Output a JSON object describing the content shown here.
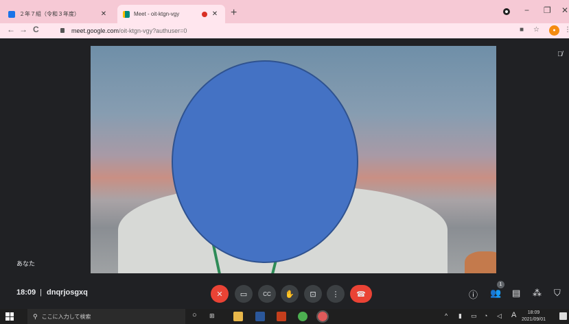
{
  "browser": {
    "tabs": [
      {
        "title": "２年７組（令和３年度）",
        "active": false
      },
      {
        "title": "Meet - oit-ktgn-vgy",
        "active": true,
        "recording": true
      }
    ],
    "new_tab_label": "+",
    "window_controls": {
      "minimize": "−",
      "restore": "❐",
      "close": "✕"
    },
    "nav": {
      "back": "←",
      "forward": "→",
      "reload": "C"
    },
    "url_host": "meet.google.com",
    "url_path": "/oit-ktgn-vgy?authuser=0"
  },
  "meet": {
    "self_label": "あなた",
    "time": "18:09",
    "separator": "|",
    "meeting_code": "dnqrjosgxq",
    "participants_count": "1"
  },
  "taskbar": {
    "search_placeholder": "ここに入力して検索",
    "ime_label": "A",
    "clock_time": "18:09",
    "clock_date": "2021/09/01"
  },
  "colors": {
    "tab_strip": "#f6c9d5",
    "meet_background": "#202124",
    "mic_off_red": "#ea4335",
    "hangup_red": "#ea4335",
    "face_mask_blue": "#4472c4"
  }
}
